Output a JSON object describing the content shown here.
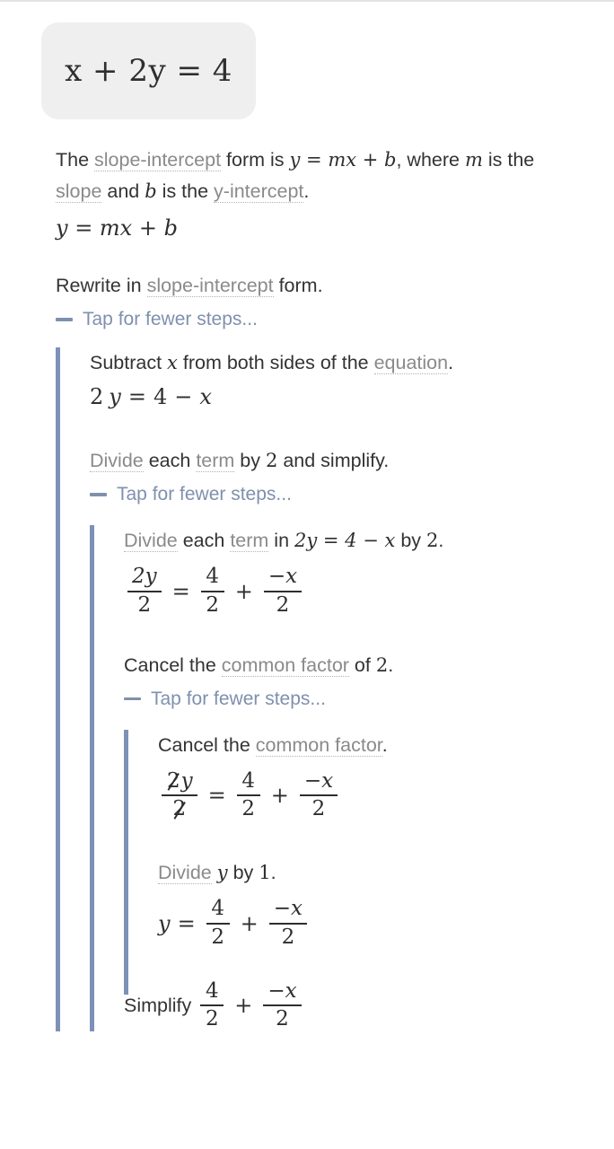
{
  "problem": {
    "expression": "x + 2y = 4"
  },
  "intro": {
    "sentence_part1": "The ",
    "link_slope_intercept": "slope-intercept",
    "sentence_part2": " form is ",
    "formula_inline": "y = mx + b",
    "sentence_part3": ", where ",
    "var_m": "m",
    "sentence_part4": " is the ",
    "link_slope": "slope",
    "sentence_part5": " and ",
    "var_b": "b",
    "sentence_part6": " is the ",
    "link_y_intercept": "y-intercept",
    "sentence_part7": ".",
    "display_formula": "y = mx + b"
  },
  "step_rewrite": {
    "text_prefix": "Rewrite in ",
    "link": "slope-intercept",
    "text_suffix": " form.",
    "toggle_label": "Tap for fewer steps..."
  },
  "step_subtract": {
    "text_prefix": "Subtract ",
    "var": "x",
    "text_mid": " from both sides of the ",
    "link": "equation",
    "text_suffix": ".",
    "equation": {
      "left_coef": "2",
      "left_var": "y",
      "equals": "=",
      "right_num": "4",
      "minus": "−",
      "right_var": "x"
    }
  },
  "step_divide": {
    "link_divide": "Divide",
    "text_each": " each ",
    "link_term": "term",
    "text_by": " by ",
    "num_2": "2",
    "text_suffix": " and simplify.",
    "toggle_label": "Tap for fewer steps..."
  },
  "step_divide_detail": {
    "link_divide": "Divide",
    "text_each": " each ",
    "link_term": "term",
    "text_in": " in ",
    "inline_eq": "2y = 4 − x",
    "text_by": " by ",
    "num_2": "2",
    "text_suffix": ".",
    "equation": {
      "f1_num": "2y",
      "f1_den": "2",
      "equals": "=",
      "f2_num": "4",
      "f2_den": "2",
      "plus": "+",
      "f3_num": "−x",
      "f3_den": "2"
    }
  },
  "step_cancel_of2": {
    "text_prefix": "Cancel the ",
    "link": "common factor",
    "text_suffix": " of ",
    "num_2": "2",
    "period": ".",
    "toggle_label": "Tap for fewer steps..."
  },
  "step_cancel": {
    "text_prefix": "Cancel the ",
    "link": "common factor",
    "text_suffix": ".",
    "equation": {
      "f1_num_cancel": "2",
      "f1_num_var": "y",
      "f1_den_cancel": "2",
      "equals": "=",
      "f2_num": "4",
      "f2_den": "2",
      "plus": "+",
      "f3_num": "−x",
      "f3_den": "2"
    }
  },
  "step_divide_by1": {
    "link_divide": "Divide",
    "text_mid": " ",
    "var_y": "y",
    "text_by": " by ",
    "num_1": "1",
    "text_suffix": ".",
    "equation": {
      "lhs": "y",
      "equals": "=",
      "f1_num": "4",
      "f1_den": "2",
      "plus": "+",
      "f2_num": "−x",
      "f2_den": "2"
    }
  },
  "step_simplify": {
    "text_prefix": "Simplify ",
    "f1_num": "4",
    "f1_den": "2",
    "plus": "+",
    "f2_num": "−x",
    "f2_den": "2"
  },
  "colors": {
    "rail": "#7d91b8",
    "toggle": "#7f90ae",
    "link": "#8a8a8a",
    "problem_box": "#efeff0",
    "text": "#333333"
  }
}
